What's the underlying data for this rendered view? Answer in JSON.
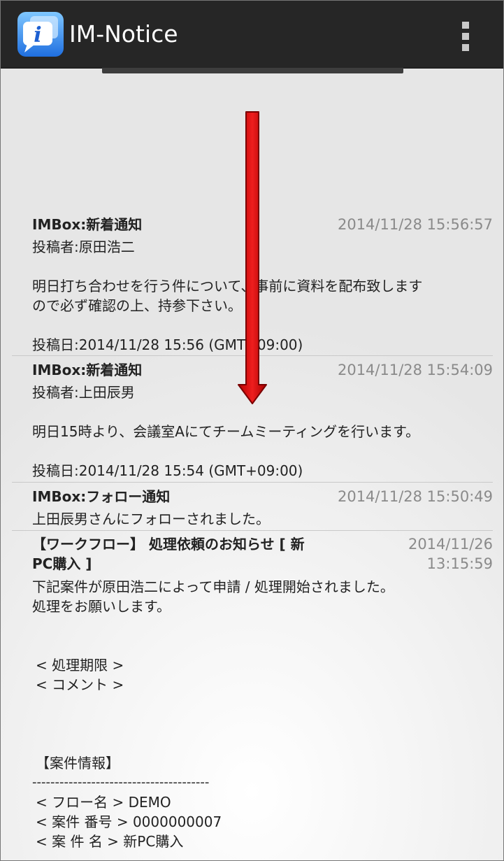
{
  "app": {
    "title": "IM-Notice"
  },
  "notifications": [
    {
      "title": "IMBox:新着通知",
      "date": "2014/11/28 15:56:57",
      "lines": [
        "投稿者:原田浩二",
        "明日打ち合わせを行う件について、事前に資料を配布致します",
        "ので必ず確認の上、持参下さい。",
        "投稿日:2014/11/28 15:56 (GMT+09:00)"
      ]
    },
    {
      "title": "IMBox:新着通知",
      "date": "2014/11/28 15:54:09",
      "lines": [
        "投稿者:上田辰男",
        "明日15時より、会議室Aにてチームミーティングを行います。",
        "投稿日:2014/11/28 15:54 (GMT+09:00)"
      ]
    },
    {
      "title": "IMBox:フォロー通知",
      "date": "2014/11/28 15:50:49",
      "lines": [
        "上田辰男さんにフォローされました。"
      ]
    },
    {
      "title_line1": "【ワークフロー】 処理依頼のお知らせ [ 新",
      "title_line2": "PC購入 ]",
      "date_line1": "2014/11/26",
      "date_line2": "13:15:59",
      "lines": [
        "下記案件が原田浩二によって申請 / 処理開始されました。",
        "処理をお願いします。",
        "<  処理期限  >",
        "<  コメント  >",
        " 【案件情報】",
        "---------------------------------------",
        "<  フロー名  > DEMO",
        "< 案件 番号 > 0000000007",
        "< 案 件 名 > 新PC購入"
      ]
    }
  ]
}
